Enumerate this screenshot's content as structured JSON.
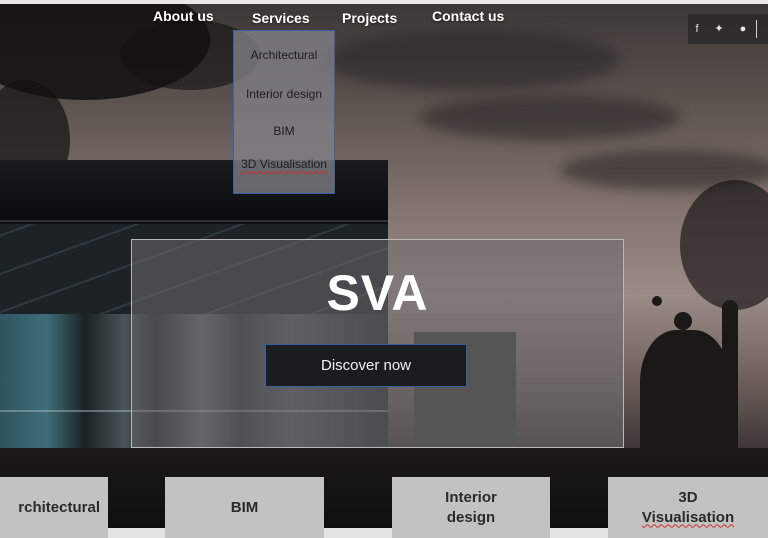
{
  "nav": {
    "items": [
      {
        "label": "About us"
      },
      {
        "label": "Services"
      },
      {
        "label": "Projects"
      },
      {
        "label": "Contact us"
      }
    ],
    "services_dropdown": [
      {
        "label": "Architectural"
      },
      {
        "label": "Interior design"
      },
      {
        "label": "BIM"
      },
      {
        "label": "3D Visualisation"
      }
    ]
  },
  "social": {
    "icons": [
      {
        "name": "facebook-icon",
        "glyph": "f"
      },
      {
        "name": "twitter-icon",
        "glyph": "✦"
      },
      {
        "name": "chat-icon",
        "glyph": "●"
      }
    ]
  },
  "hero": {
    "title": "SVA",
    "cta_label": "Discover now"
  },
  "cards": [
    {
      "label": "rchitectural"
    },
    {
      "label": "BIM"
    },
    {
      "label_line1": "Interior",
      "label_line2": "design"
    },
    {
      "label_line1": "3D",
      "label_line2": "Visualisation"
    }
  ],
  "colors": {
    "accent_border": "#3b5fa8",
    "card_bg": "#c2c2c2",
    "cta_bg": "#1b1c1e"
  }
}
